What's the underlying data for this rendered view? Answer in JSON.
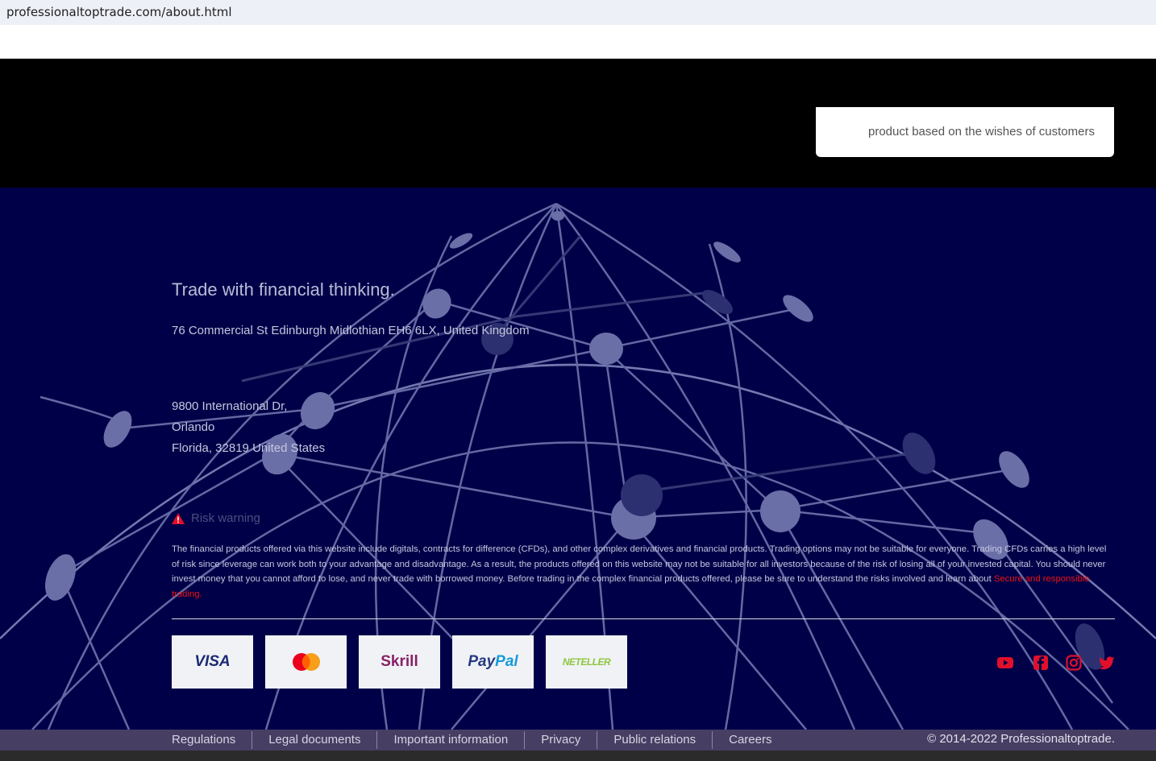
{
  "browser": {
    "url": "professionaltoptrade.com/about.html"
  },
  "hero": {
    "card_text": "product based on the wishes of customers"
  },
  "footer": {
    "tagline": "Trade with financial thinking.",
    "address_uk": "76 Commercial St Edinburgh Midlothian EH6 6LX, United Kingdom",
    "address_us_line1": "9800 International Dr,",
    "address_us_line2": "Orlando",
    "address_us_line3": "Florida, 32819 United States",
    "risk_title": "Risk warning",
    "disclaimer": "The financial products offered via this website include digitals, contracts for difference (CFDs), and other complex derivatives and financial products. Trading options may not be suitable for everyone. Trading CFDs carries a high level of risk since leverage can work both to your advantage and disadvantage. As a result, the products offered on this website may not be suitable for all investors because of the risk of losing all of your invested capital. You should never invest money that you cannot afford to lose, and never trade with borrowed money. Before trading in the complex financial products offered, please be sure to understand the risks involved and learn about",
    "disclaimer_link": "Secure and responsible trading.",
    "payments": {
      "visa": "VISA",
      "skrill": "Skrill",
      "paypal_a": "Pay",
      "paypal_b": "Pal",
      "neteller": "NETELLER"
    },
    "social_icons": [
      "youtube-icon",
      "facebook-icon",
      "instagram-icon",
      "twitter-icon"
    ],
    "accent_color": "#e0102a"
  },
  "bottom_nav": {
    "links": [
      "Regulations",
      "Legal documents",
      "Important information",
      "Privacy",
      "Public relations",
      "Careers"
    ],
    "copyright": "© 2014-2022 Professionaltoptrade."
  }
}
